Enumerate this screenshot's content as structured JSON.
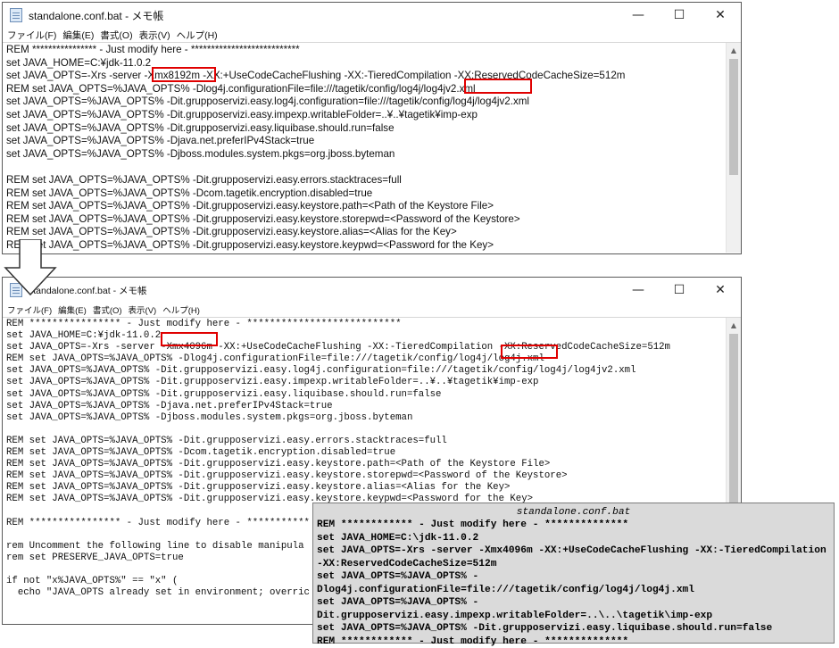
{
  "top_window": {
    "title": "standalone.conf.bat - メモ帳",
    "controls": {
      "minimize": "—",
      "maximize": "☐",
      "close": "✕"
    },
    "menu": [
      "ファイル(F)",
      "編集(E)",
      "書式(O)",
      "表示(V)",
      "ヘルプ(H)"
    ],
    "lines": [
      "REM **************** - Just modify here - ***************************",
      "set JAVA_HOME=C:¥jdk-11.0.2",
      "set JAVA_OPTS=-Xrs -server -Xmx8192m -XX:+UseCodeCacheFlushing -XX:-TieredCompilation -XX:ReservedCodeCacheSize=512m",
      "REM set JAVA_OPTS=%JAVA_OPTS% -Dlog4j.configurationFile=file:///tagetik/config/log4j/log4jv2.xml",
      "set JAVA_OPTS=%JAVA_OPTS% -Dit.grupposervizi.easy.log4j.configuration=file:///tagetik/config/log4j/log4jv2.xml",
      "set JAVA_OPTS=%JAVA_OPTS% -Dit.grupposervizi.easy.impexp.writableFolder=..¥..¥tagetik¥imp-exp",
      "set JAVA_OPTS=%JAVA_OPTS% -Dit.grupposervizi.easy.liquibase.should.run=false",
      "set JAVA_OPTS=%JAVA_OPTS% -Djava.net.preferIPv4Stack=true",
      "set JAVA_OPTS=%JAVA_OPTS% -Djboss.modules.system.pkgs=org.jboss.byteman",
      "",
      "REM set JAVA_OPTS=%JAVA_OPTS% -Dit.grupposervizi.easy.errors.stacktraces=full",
      "REM set JAVA_OPTS=%JAVA_OPTS% -Dcom.tagetik.encryption.disabled=true",
      "REM set JAVA_OPTS=%JAVA_OPTS% -Dit.grupposervizi.easy.keystore.path=<Path of the Keystore File>",
      "REM set JAVA_OPTS=%JAVA_OPTS% -Dit.grupposervizi.easy.keystore.storepwd=<Password of the Keystore>",
      "REM set JAVA_OPTS=%JAVA_OPTS% -Dit.grupposervizi.easy.keystore.alias=<Alias for the Key>",
      "REM set JAVA_OPTS=%JAVA_OPTS% -Dit.grupposervizi.easy.keystore.keypwd=<Password for the Key>"
    ]
  },
  "bottom_window": {
    "title": "standalone.conf.bat - メモ帳",
    "controls": {
      "minimize": "—",
      "maximize": "☐",
      "close": "✕"
    },
    "menu": [
      "ファイル(F)",
      "編集(E)",
      "書式(O)",
      "表示(V)",
      "ヘルプ(H)"
    ],
    "lines": [
      "REM **************** - Just modify here - ***************************",
      "set JAVA_HOME=C:¥jdk-11.0.2",
      "set JAVA_OPTS=-Xrs -server -Xmx4096m -XX:+UseCodeCacheFlushing -XX:-TieredCompilation -XX:ReservedCodeCacheSize=512m",
      "REM set JAVA_OPTS=%JAVA_OPTS% -Dlog4j.configurationFile=file:///tagetik/config/log4j/log4j.xml",
      "set JAVA_OPTS=%JAVA_OPTS% -Dit.grupposervizi.easy.log4j.configuration=file:///tagetik/config/log4j/log4jv2.xml",
      "set JAVA_OPTS=%JAVA_OPTS% -Dit.grupposervizi.easy.impexp.writableFolder=..¥..¥tagetik¥imp-exp",
      "set JAVA_OPTS=%JAVA_OPTS% -Dit.grupposervizi.easy.liquibase.should.run=false",
      "set JAVA_OPTS=%JAVA_OPTS% -Djava.net.preferIPv4Stack=true",
      "set JAVA_OPTS=%JAVA_OPTS% -Djboss.modules.system.pkgs=org.jboss.byteman",
      "",
      "REM set JAVA_OPTS=%JAVA_OPTS% -Dit.grupposervizi.easy.errors.stacktraces=full",
      "REM set JAVA_OPTS=%JAVA_OPTS% -Dcom.tagetik.encryption.disabled=true",
      "REM set JAVA_OPTS=%JAVA_OPTS% -Dit.grupposervizi.easy.keystore.path=<Path of the Keystore File>",
      "REM set JAVA_OPTS=%JAVA_OPTS% -Dit.grupposervizi.easy.keystore.storepwd=<Password of the Keystore>",
      "REM set JAVA_OPTS=%JAVA_OPTS% -Dit.grupposervizi.easy.keystore.alias=<Alias for the Key>",
      "REM set JAVA_OPTS=%JAVA_OPTS% -Dit.grupposervizi.easy.keystore.keypwd=<Password for the Key>",
      "",
      "REM **************** - Just modify here - ***********",
      "",
      "rem Uncomment the following line to disable manipula",
      "rem set PRESERVE_JAVA_OPTS=true",
      "",
      "if not \"x%JAVA_OPTS%\" == \"x\" (",
      "  echo \"JAVA_OPTS already set in environment; overric"
    ]
  },
  "popup": {
    "title": "standalone.conf.bat",
    "lines": [
      "REM ************ - Just modify here - **************",
      "set JAVA_HOME=C:\\jdk-11.0.2",
      "set JAVA_OPTS=-Xrs -server -Xmx4096m -XX:+UseCodeCacheFlushing -XX:-TieredCompilation -XX:ReservedCodeCacheSize=512m",
      "set JAVA_OPTS=%JAVA_OPTS% -Dlog4j.configurationFile=file:///tagetik/config/log4j/log4j.xml",
      "set JAVA_OPTS=%JAVA_OPTS% -Dit.grupposervizi.easy.impexp.writableFolder=..\\..\\tagetik\\imp-exp",
      "set JAVA_OPTS=%JAVA_OPTS% -Dit.grupposervizi.easy.liquibase.should.run=false",
      "REM ************ - Just modify here - **************"
    ]
  },
  "colors": {
    "highlight": "#e00000",
    "popup_bg": "#dadada"
  }
}
